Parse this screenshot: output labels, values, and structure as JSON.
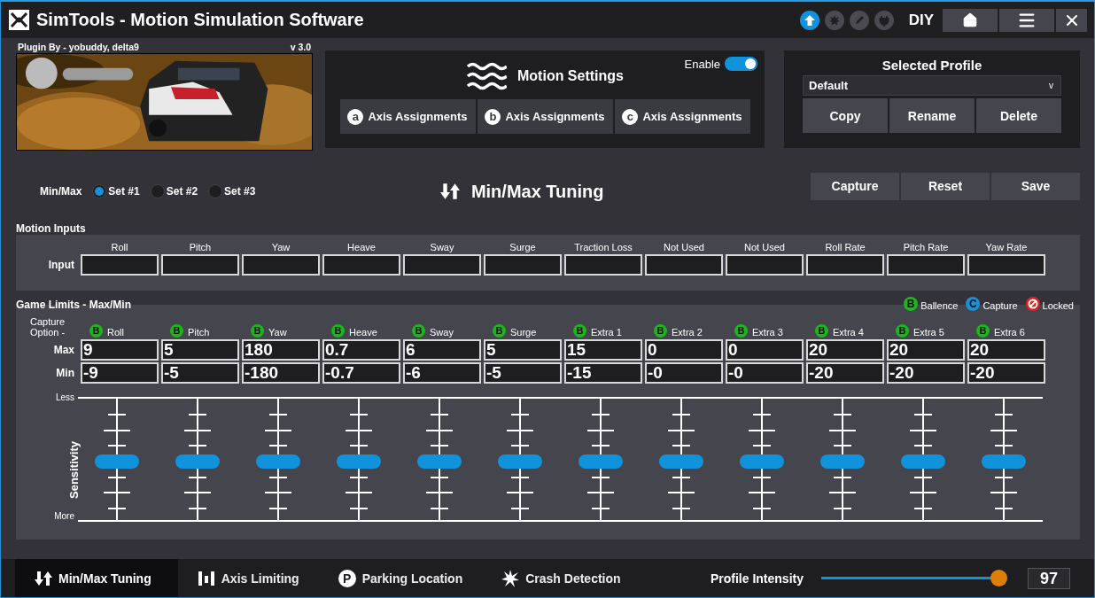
{
  "window": {
    "title": "SimTools - Motion Simulation Software",
    "mode": "DIY",
    "status_icons": [
      {
        "kind": "upload",
        "active": true
      },
      {
        "kind": "burst",
        "active": false
      },
      {
        "kind": "pencil",
        "active": false
      },
      {
        "kind": "plug",
        "active": false
      }
    ]
  },
  "plugin": {
    "credit": "Plugin By - yobuddy, delta9",
    "version": "v 3.0"
  },
  "motion_settings": {
    "title": "Motion Settings",
    "enable_label": "Enable",
    "enabled": true,
    "axis_buttons": [
      {
        "badge": "a",
        "label": "Axis Assignments"
      },
      {
        "badge": "b",
        "label": "Axis Assignments"
      },
      {
        "badge": "c",
        "label": "Axis Assignments"
      }
    ]
  },
  "profile": {
    "title": "Selected Profile",
    "value": "Default",
    "caret": "v",
    "buttons": [
      "Copy",
      "Rename",
      "Delete"
    ]
  },
  "minmax": {
    "label": "Min/Max",
    "title": "Min/Max Tuning",
    "buttons": [
      "Capture",
      "Reset",
      "Save"
    ],
    "sets": [
      {
        "label": "Set #1",
        "selected": true
      },
      {
        "label": "Set #2",
        "selected": false
      },
      {
        "label": "Set #3",
        "selected": false
      }
    ]
  },
  "motion_inputs": {
    "title": "Motion Inputs",
    "row_label": "Input",
    "columns": [
      "Roll",
      "Pitch",
      "Yaw",
      "Heave",
      "Sway",
      "Surge",
      "Traction Loss",
      "Not Used",
      "Not Used",
      "Roll Rate",
      "Pitch Rate",
      "Yaw Rate"
    ]
  },
  "game_limits": {
    "title": "Game Limits - Max/Min",
    "option_label": "Capture Option -",
    "max_label": "Max",
    "min_label": "Min",
    "less_label": "Less",
    "more_label": "More",
    "sensitivity_label": "Sensitivity",
    "legend": [
      {
        "kind": "letter",
        "badge": "B",
        "label": "Ballence",
        "color": "#1cb51c"
      },
      {
        "kind": "letter",
        "badge": "C",
        "label": "Capture",
        "color": "#1a8fd6"
      },
      {
        "kind": "locked",
        "label": "Locked",
        "color": "#e0201e"
      }
    ],
    "axes": [
      {
        "badge": "B",
        "color": "#1cb51c",
        "name": "Roll",
        "max": "9",
        "min": "-9",
        "level": 0.5
      },
      {
        "badge": "B",
        "color": "#1cb51c",
        "name": "Pitch",
        "max": "5",
        "min": "-5",
        "level": 0.5
      },
      {
        "badge": "B",
        "color": "#1cb51c",
        "name": "Yaw",
        "max": "180",
        "min": "-180",
        "level": 0.5
      },
      {
        "badge": "B",
        "color": "#1cb51c",
        "name": "Heave",
        "max": "0.7",
        "min": "-0.7",
        "level": 0.5
      },
      {
        "badge": "B",
        "color": "#1cb51c",
        "name": "Sway",
        "max": "6",
        "min": "-6",
        "level": 0.5
      },
      {
        "badge": "B",
        "color": "#1cb51c",
        "name": "Surge",
        "max": "5",
        "min": "-5",
        "level": 0.5
      },
      {
        "badge": "B",
        "color": "#1cb51c",
        "name": "Extra 1",
        "max": "15",
        "min": "-15",
        "level": 0.5
      },
      {
        "badge": "B",
        "color": "#1cb51c",
        "name": "Extra 2",
        "max": "0",
        "min": "-0",
        "level": 0.5
      },
      {
        "badge": "B",
        "color": "#1cb51c",
        "name": "Extra 3",
        "max": "0",
        "min": "-0",
        "level": 0.5
      },
      {
        "badge": "B",
        "color": "#1cb51c",
        "name": "Extra 4",
        "max": "20",
        "min": "-20",
        "level": 0.5
      },
      {
        "badge": "B",
        "color": "#1cb51c",
        "name": "Extra 5",
        "max": "20",
        "min": "-20",
        "level": 0.5
      },
      {
        "badge": "B",
        "color": "#1cb51c",
        "name": "Extra 6",
        "max": "20",
        "min": "-20",
        "level": 0.5
      }
    ]
  },
  "bottom_tabs": [
    {
      "kind": "minmax",
      "label": "Min/Max Tuning",
      "selected": true
    },
    {
      "kind": "bars",
      "label": "Axis Limiting",
      "selected": false
    },
    {
      "kind": "parking",
      "badge": "P",
      "label": "Parking Location",
      "selected": false
    },
    {
      "kind": "crash",
      "label": "Crash Detection",
      "selected": false
    }
  ],
  "intensity": {
    "label": "Profile Intensity",
    "level": 0.97,
    "value": "97"
  }
}
